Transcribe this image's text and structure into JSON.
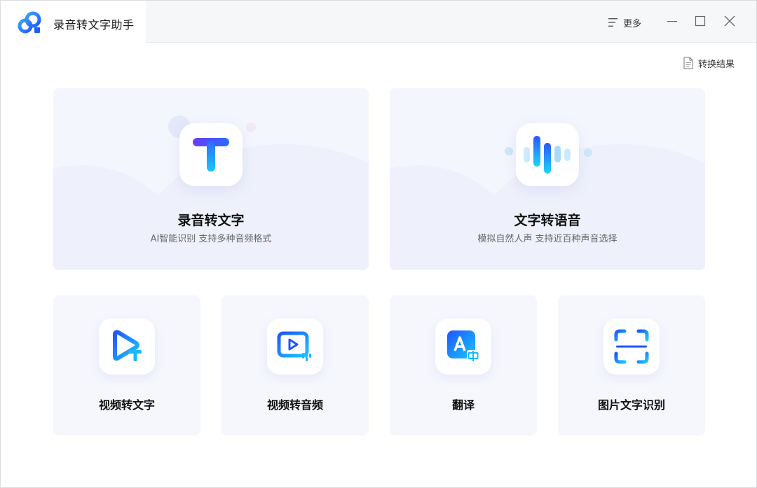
{
  "app": {
    "title": "录音转文字助手"
  },
  "titlebar": {
    "more_label": "更多"
  },
  "toolbar": {
    "result_label": "转换结果"
  },
  "big_cards": [
    {
      "title": "录音转文字",
      "subtitle": "AI智能识别 支持多种音频格式",
      "icon": "text-t-icon"
    },
    {
      "title": "文字转语音",
      "subtitle": "模拟自然人声 支持近百种声音选择",
      "icon": "sound-wave-icon"
    }
  ],
  "small_cards": [
    {
      "title": "视频转文字",
      "icon": "video-to-text-icon"
    },
    {
      "title": "视频转音频",
      "icon": "video-to-audio-icon"
    },
    {
      "title": "翻译",
      "icon": "translate-icon"
    },
    {
      "title": "图片文字识别",
      "icon": "image-ocr-icon"
    }
  ],
  "colors": {
    "accent_blue": "#1f6bff",
    "accent_purple": "#6a3cff",
    "accent_cyan": "#19d0ff",
    "card_bg": "#f4f6fd"
  }
}
